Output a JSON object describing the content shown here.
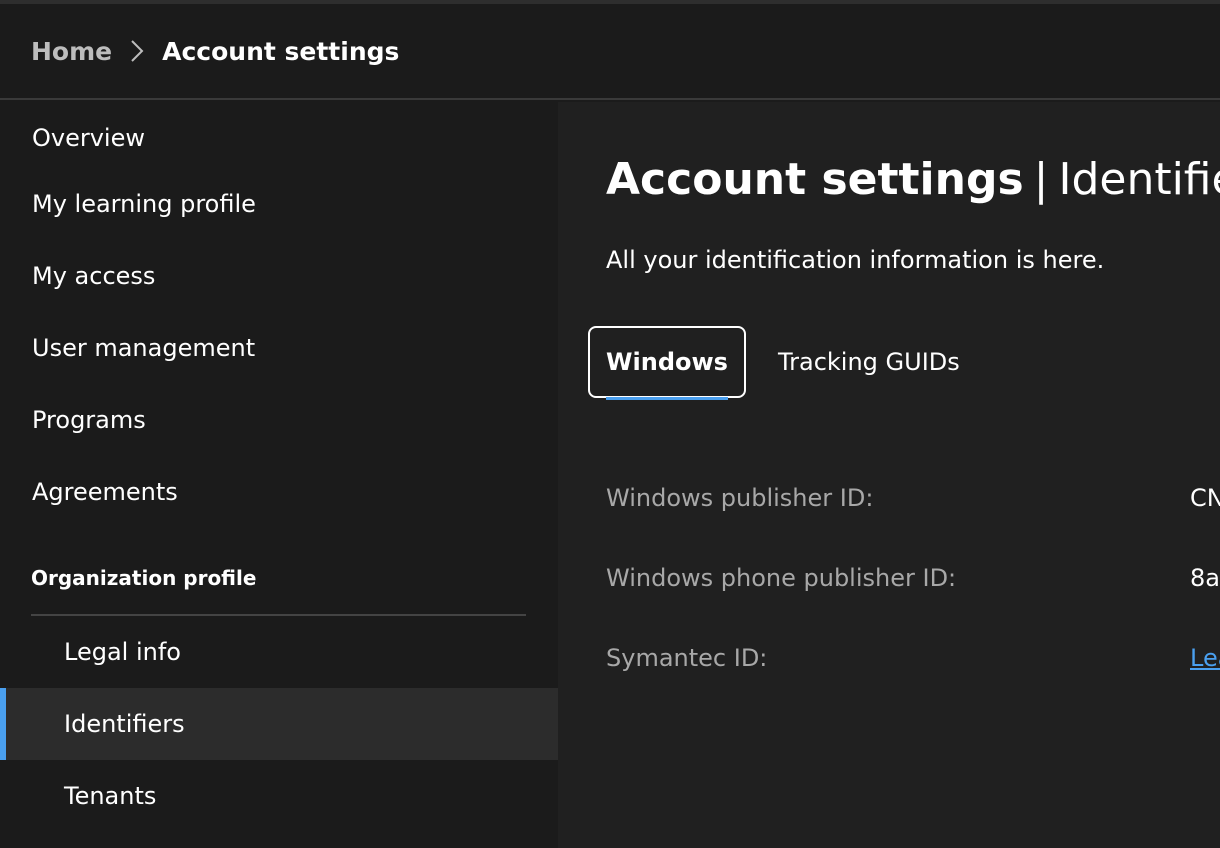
{
  "breadcrumb": {
    "home": "Home",
    "separator_icon": "chevron-right-icon",
    "current": "Account settings"
  },
  "sidebar": {
    "items": [
      {
        "label": "Overview"
      },
      {
        "label": "My learning profile"
      },
      {
        "label": "My access"
      },
      {
        "label": "User management"
      },
      {
        "label": "Programs"
      },
      {
        "label": "Agreements"
      }
    ],
    "section_heading": "Organization profile",
    "sub_items": [
      {
        "label": "Legal info"
      },
      {
        "label": "Identifiers",
        "active": true
      },
      {
        "label": "Tenants"
      }
    ]
  },
  "main": {
    "title_strong": "Account settings",
    "title_sep": "|",
    "title_light": "Identifiers",
    "subtitle": "All your identification information is here.",
    "tabs": [
      {
        "label": "Windows",
        "selected": true
      },
      {
        "label": "Tracking GUIDs"
      }
    ],
    "fields": [
      {
        "label": "Windows publisher ID:",
        "value": "CN"
      },
      {
        "label": "Windows phone publisher ID:",
        "value": "8a"
      },
      {
        "label": "Symantec ID:",
        "value": "Lea"
      }
    ]
  },
  "colors": {
    "background": "#1b1b1b",
    "main_background": "#202020",
    "accent": "#4aa0f0",
    "active_item": "#2c2c2c",
    "muted_text": "#a8a8a8"
  }
}
